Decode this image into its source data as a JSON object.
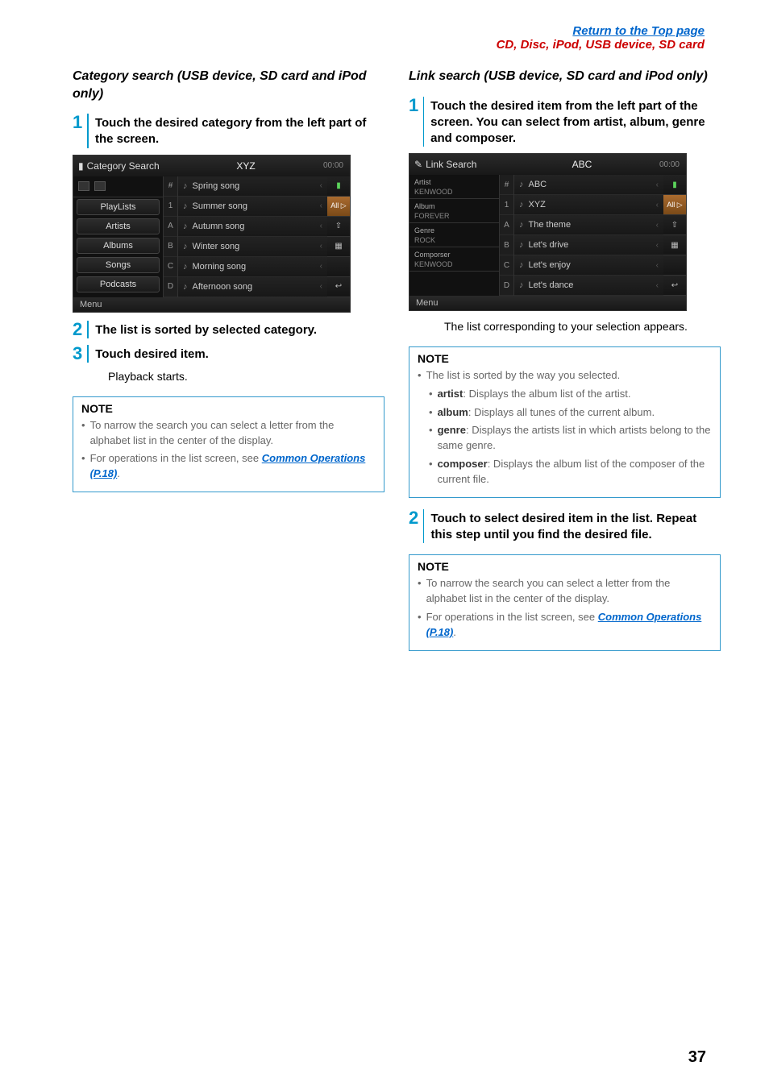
{
  "header": {
    "top_link": "Return to the Top page",
    "breadcrumb": "CD, Disc, iPod, USB device, SD card"
  },
  "left": {
    "title": "Category search (USB device, SD card and iPod only)",
    "step1": "Touch the desired category from the left part of the screen.",
    "screen": {
      "screen_label": "Category Search",
      "title": "XYZ",
      "time": "00:00",
      "left_icons": [
        "folder",
        "music"
      ],
      "cats": [
        "PlayLists",
        "Artists",
        "Albums",
        "Songs",
        "Podcasts"
      ],
      "alpha": [
        "#",
        "1",
        "A",
        "B",
        "C",
        "D"
      ],
      "rows": [
        "Spring song",
        "Summer song",
        "Autumn song",
        "Winter song",
        "Morning song",
        "Afternoon song"
      ],
      "right_icons": [
        "play",
        "All ▷",
        "up",
        "grid",
        "",
        "back"
      ],
      "menu": "Menu"
    },
    "step2": "The list is sorted by selected category.",
    "step3": "Touch desired item.",
    "step3_sub": "Playback starts.",
    "note_title": "NOTE",
    "note_b1": "To narrow the search you can select a letter from the alphabet list in the center of the display.",
    "note_b2_pre": "For operations in the list screen, see ",
    "note_b2_link": "Common Operations (P.18)",
    "note_b2_post": "."
  },
  "right": {
    "title": "Link search (USB device, SD card and iPod only)",
    "step1": "Touch the desired item from the left part of the screen. You can select from artist, album, genre and composer.",
    "screen": {
      "screen_label": "Link Search",
      "title": "ABC",
      "time": "00:00",
      "meta": [
        {
          "k": "Artist",
          "v": "KENWOOD"
        },
        {
          "k": "Album",
          "v": "FOREVER"
        },
        {
          "k": "Genre",
          "v": "ROCK"
        },
        {
          "k": "Comporser",
          "v": "KENWOOD"
        }
      ],
      "alpha": [
        "#",
        "1",
        "A",
        "B",
        "C",
        "D"
      ],
      "rows": [
        "ABC",
        "XYZ",
        "The theme",
        "Let's drive",
        "Let's enjoy",
        "Let's dance"
      ],
      "right_icons": [
        "play",
        "All ▷",
        "up",
        "grid",
        "",
        "back"
      ],
      "menu": "Menu"
    },
    "step1_sub": "The list corresponding to your selection appears.",
    "note1_title": "NOTE",
    "note1_b1": "The list is sorted by the way you selected.",
    "note1_artist_k": "artist",
    "note1_artist_v": ": Displays the album list of the artist.",
    "note1_album_k": "album",
    "note1_album_v": ": Displays all tunes of the current album.",
    "note1_genre_k": "genre",
    "note1_genre_v": ": Displays the artists list in which artists belong to the same genre.",
    "note1_composer_k": "composer",
    "note1_composer_v": ": Displays the album list of the composer of the current file.",
    "step2": "Touch to select desired item in the list. Repeat this step until you find the desired file.",
    "note2_title": "NOTE",
    "note2_b1": "To narrow the search you can select a letter from the alphabet list in the center of the display.",
    "note2_b2_pre": "For operations in the list screen, see ",
    "note2_b2_link": "Common Operations (P.18)",
    "note2_b2_post": "."
  },
  "page": "37"
}
